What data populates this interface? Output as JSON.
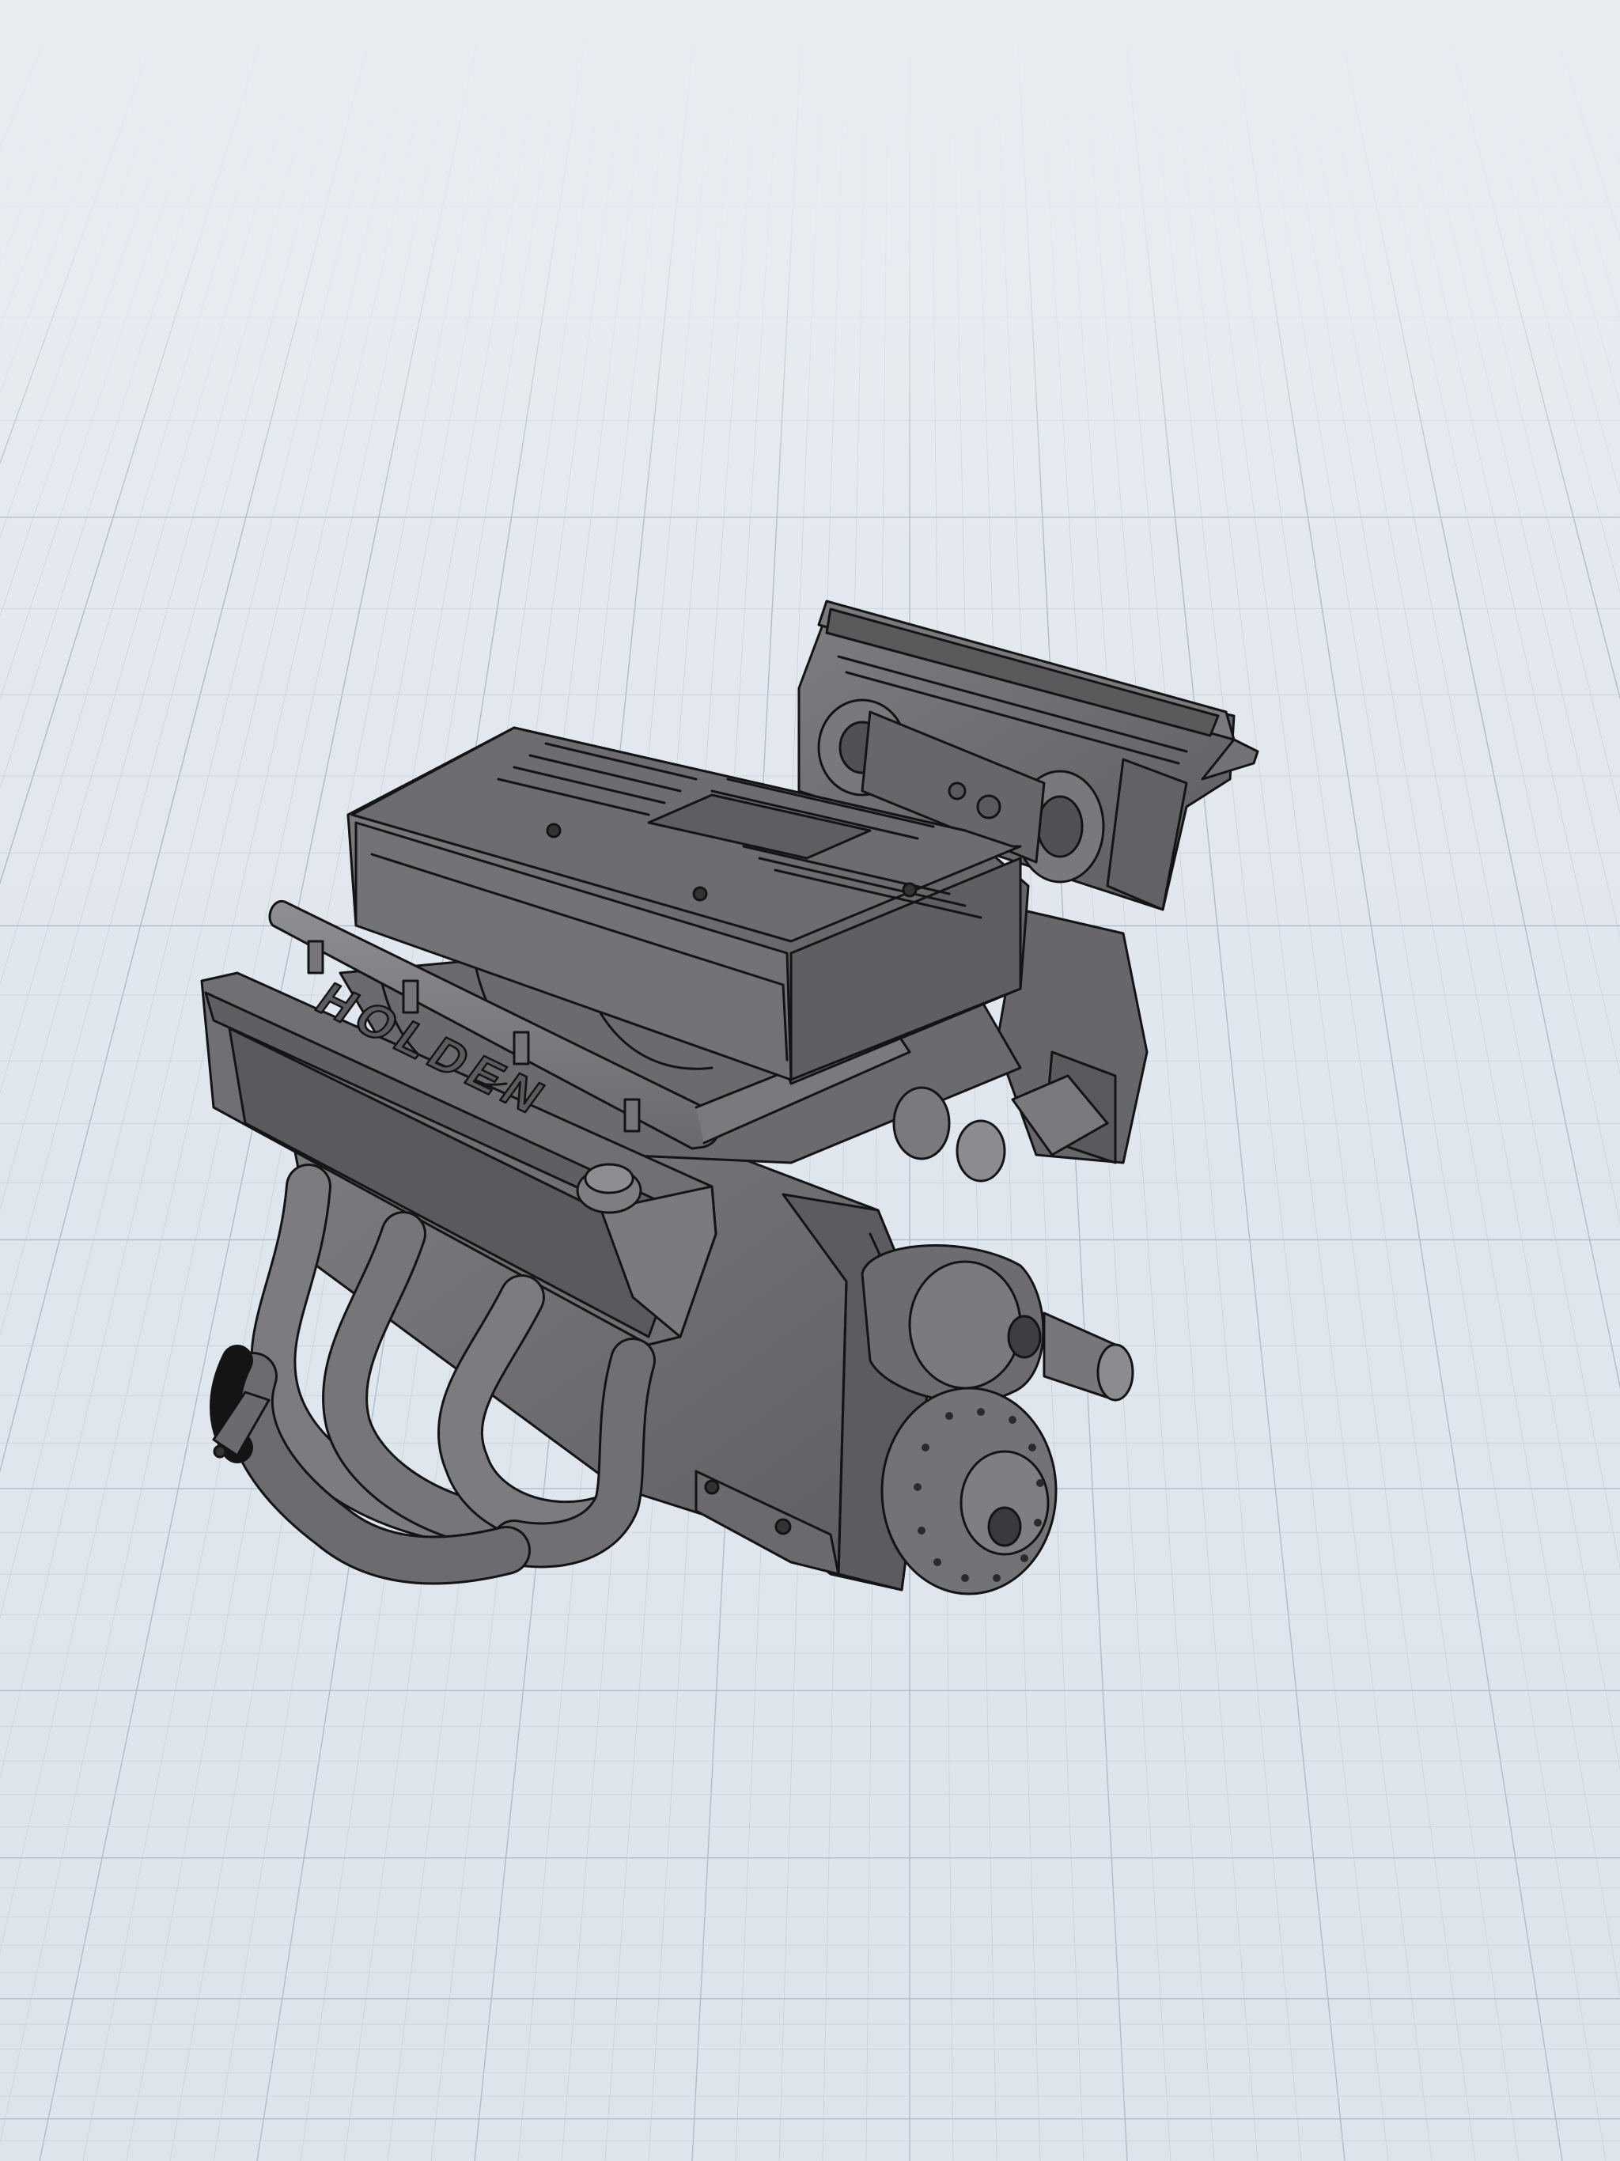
{
  "viewport": {
    "background_color": "#e4e9ef",
    "grid_minor_color": "#c9d3de",
    "grid_major_color": "#aebccb"
  },
  "model": {
    "badge_text": "HOLDEN",
    "body_color": "#6f6f72",
    "dark_color": "#4a4a4d",
    "light_color": "#8a8a8e",
    "edge_color": "#141414"
  }
}
